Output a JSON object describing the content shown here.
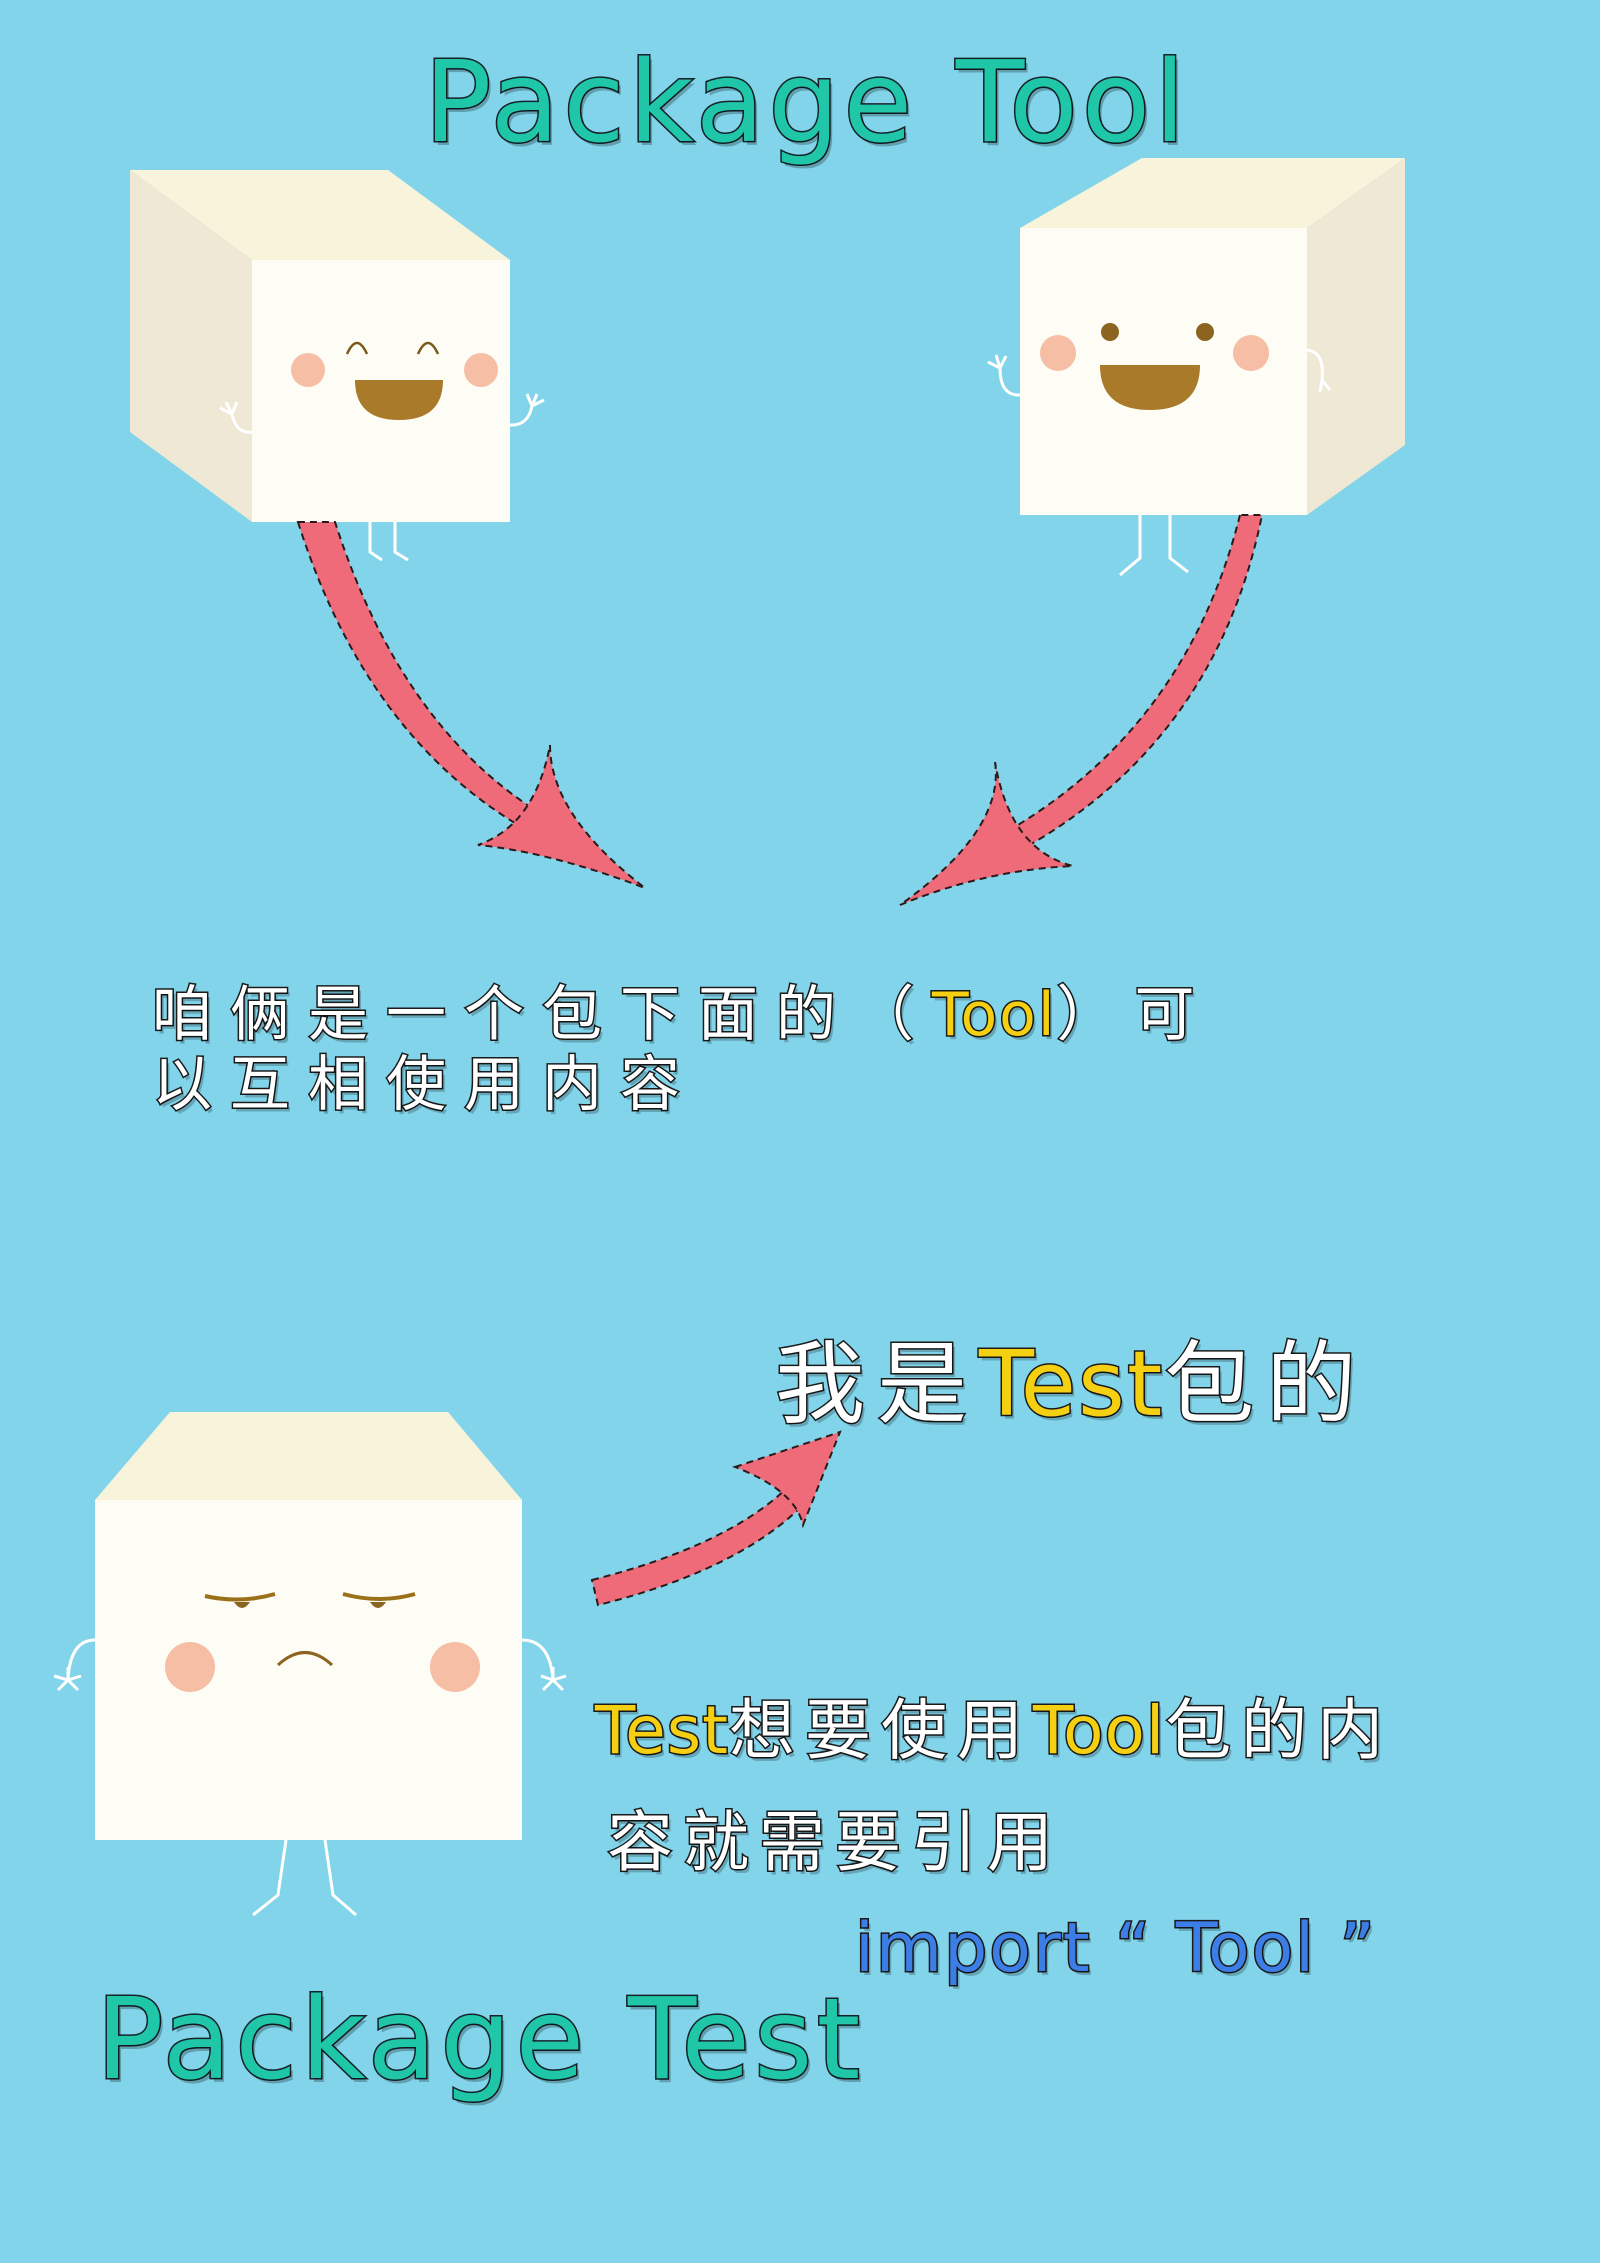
{
  "titles": {
    "top": "Package Tool",
    "bottom": "Package Test"
  },
  "caption1": {
    "line1_pre": "咱俩是一个包下面的（",
    "line1_highlight": "Tool",
    "line1_post": "）可",
    "line2": "以互相使用内容"
  },
  "caption2": {
    "pre": "我是",
    "highlight": "Test",
    "post": "包的"
  },
  "caption3": {
    "line1_a": "Test",
    "line1_b": "想要使用",
    "line1_c": "Tool",
    "line1_d": "包的内",
    "line2": "容就需要引用",
    "line3": "import “ Tool ”"
  },
  "colors": {
    "background": "#82d4ea",
    "title": "#1fc7a8",
    "highlight": "#f4cf12",
    "code": "#3d7ee6",
    "arrow": "#ef6b7a",
    "cube_front": "#fdfdf6",
    "cube_side": "#eee8d4",
    "cube_top": "#f8f4dc",
    "cheek": "#f6bea4",
    "mouth": "#a87a2a"
  },
  "icons": [
    "happy-cube-icon",
    "smiling-cube-icon",
    "grumpy-cube-icon",
    "arrow-icon"
  ]
}
